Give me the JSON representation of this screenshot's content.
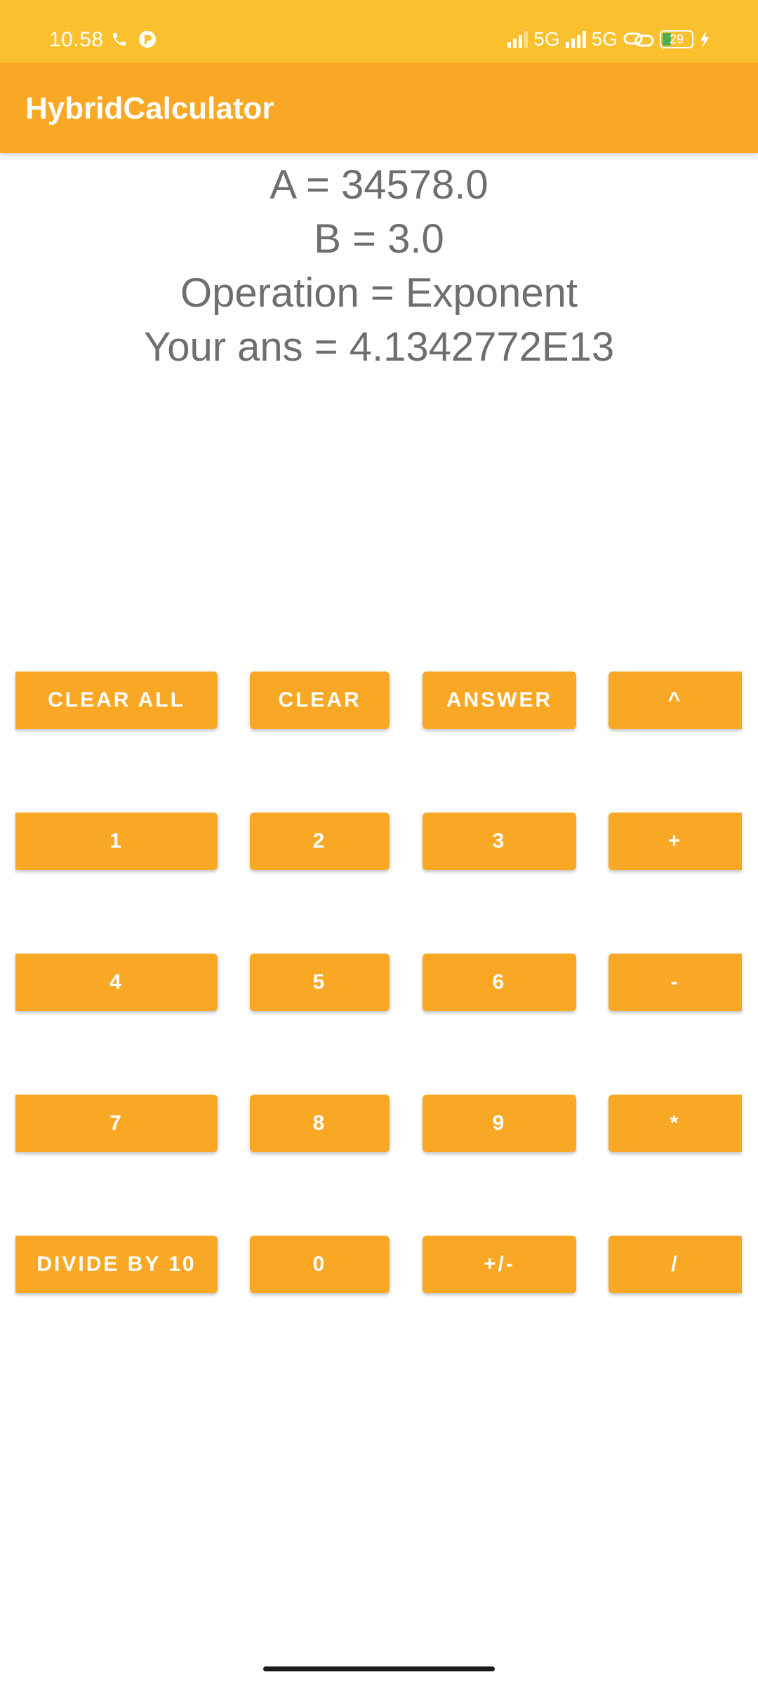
{
  "status_bar": {
    "time": "10.58",
    "network_1": "5G",
    "network_2": "5G",
    "battery_level": "29",
    "icons": [
      "phone-icon",
      "notification-app-icon",
      "signal-icon",
      "signal-icon",
      "link-icon",
      "battery-icon",
      "charging-icon"
    ],
    "background_color": "#fbc02d"
  },
  "app_bar": {
    "title": "HybridCalculator",
    "background_color": "#f9a825"
  },
  "display": {
    "a_line": "A = 34578.0",
    "b_line": "B = 3.0",
    "operation_line": "Operation = Exponent",
    "answer_line": "Your ans = 4.1342772E13"
  },
  "keypad": {
    "clear_all": "CLEAR ALL",
    "clear": "CLEAR",
    "answer": "ANSWER",
    "power": "^",
    "one": "1",
    "two": "2",
    "three": "3",
    "plus": "+",
    "four": "4",
    "five": "5",
    "six": "6",
    "minus": "-",
    "seven": "7",
    "eight": "8",
    "nine": "9",
    "multiply": "*",
    "divide_by_10": "DIVIDE BY 10",
    "zero": "0",
    "negate": "+/-",
    "divide": "/",
    "button_color": "#f9a825"
  }
}
